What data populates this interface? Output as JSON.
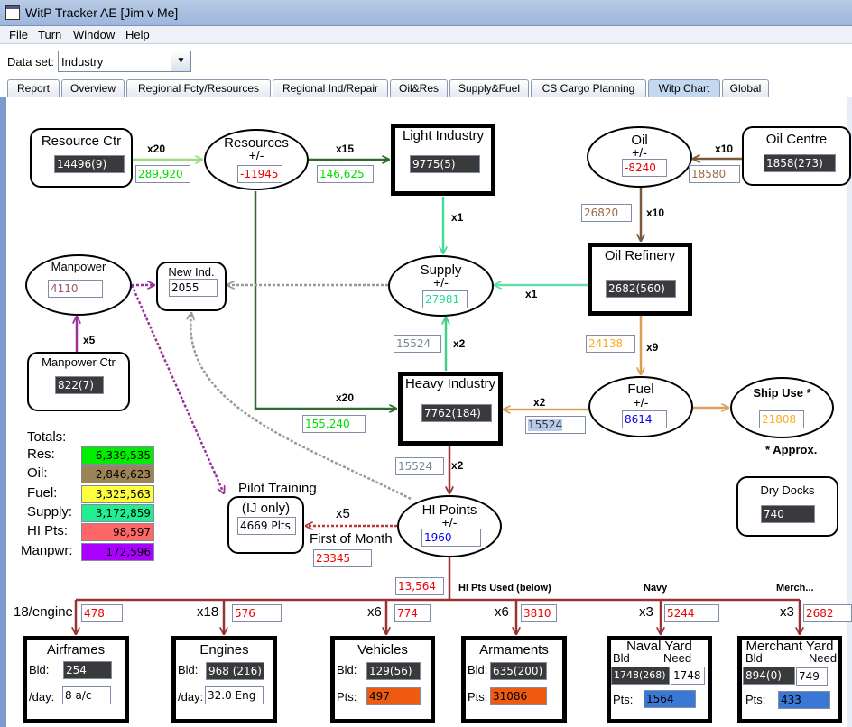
{
  "window": {
    "title": "WitP Tracker AE [Jim v Me]"
  },
  "menu": [
    "File",
    "Turn",
    "Window",
    "Help"
  ],
  "dataset": {
    "label": "Data set:",
    "value": "Industry"
  },
  "tabs": [
    "Report",
    "Overview",
    "Regional Fcty/Resources",
    "Regional Ind/Repair",
    "Oil&Res",
    "Supply&Fuel",
    "CS Cargo Planning",
    "Witp Chart",
    "Global"
  ],
  "selected_tab": "Witp Chart",
  "nodes": {
    "resource_ctr": {
      "title": "Resource Ctr",
      "value": "14496(9)"
    },
    "resources": {
      "title": "Resources",
      "sub": "+/-",
      "value": "-11945"
    },
    "light_industry": {
      "title": "Light Industry",
      "value": "9775(5)"
    },
    "oil": {
      "title": "Oil",
      "sub": "+/-",
      "value": "-8240"
    },
    "oil_centre": {
      "title": "Oil Centre",
      "value": "1858(273)"
    },
    "oil_refinery": {
      "title": "Oil Refinery",
      "value": "2682(560)"
    },
    "supply": {
      "title": "Supply",
      "sub": "+/-",
      "value": "27981"
    },
    "manpower": {
      "title": "Manpower",
      "value": "4110"
    },
    "new_ind": {
      "title": "New Ind.",
      "value": "2055"
    },
    "manpower_ctr": {
      "title": "Manpower Ctr",
      "value": "822(7)"
    },
    "heavy_industry": {
      "title": "Heavy Industry",
      "value": "7762(184)"
    },
    "fuel": {
      "title": "Fuel",
      "sub": "+/-",
      "value": "8614"
    },
    "ship_use": {
      "title": "Ship Use *",
      "value": "21808"
    },
    "approx": "* Approx.",
    "dry_docks": {
      "title": "Dry Docks",
      "value": "740"
    },
    "hi_points": {
      "title": "HI Points",
      "sub": "+/-",
      "value": "1960"
    },
    "pilot_training": {
      "title": "Pilot Training",
      "sub": "(IJ only)",
      "value": "4669 Plts"
    }
  },
  "flows": {
    "rc_res": {
      "mult": "x20",
      "value": "289,920"
    },
    "res_li": {
      "mult": "x15",
      "value": "146,625"
    },
    "oc_oil": {
      "mult": "x10",
      "value": "18580"
    },
    "oil_ref": {
      "mult": "x10",
      "value": "26820"
    },
    "li_sup": {
      "mult": "x1"
    },
    "ref_sup": {
      "mult": "x1"
    },
    "mpc_mp": {
      "mult": "x5"
    },
    "hi_sup": {
      "mult": "x2",
      "value": "15524"
    },
    "ref_fuel": {
      "mult": "x9",
      "value": "24138"
    },
    "res_hi": {
      "mult": "x20",
      "value": "155,240"
    },
    "fuel_hi": {
      "mult": "x2",
      "value": "15524"
    },
    "hi_hip": {
      "mult": "x2",
      "value": "15524"
    },
    "hip_pilot": {
      "mult": "x5",
      "note": "First of Month",
      "value": "23345"
    },
    "hip_used": {
      "value": "13,564",
      "label": "HI Pts Used (below)"
    }
  },
  "section_labels": {
    "navy": "Navy",
    "merch": "Merch..."
  },
  "totals": {
    "title": "Totals:",
    "rows": [
      {
        "label": "Res:",
        "value": "6,339,535",
        "color": "#00ee00"
      },
      {
        "label": "Oil:",
        "value": "2,846,623",
        "color": "#9c8456"
      },
      {
        "label": "Fuel:",
        "value": "3,325,563",
        "color": "#ffff40"
      },
      {
        "label": "Supply:",
        "value": "3,172,859",
        "color": "#20ee90"
      },
      {
        "label": "HI Pts:",
        "value": "98,597",
        "color": "#ff6666"
      },
      {
        "label": "Manpwr:",
        "value": "172,596",
        "color": "#aa00ff"
      }
    ]
  },
  "production": [
    {
      "mult": "18/engine",
      "used": "478",
      "title": "Airframes",
      "r1": "Bld:",
      "v1": "254",
      "r2": "/day:",
      "v2": "8 a/c"
    },
    {
      "mult": "x18",
      "used": "576",
      "title": "Engines",
      "r1": "Bld:",
      "v1": "968 (216)",
      "r2": "/day:",
      "v2": "32.0 Eng"
    },
    {
      "mult": "x6",
      "used": "774",
      "title": "Vehicles",
      "r1": "Bld:",
      "v1": "129(56)",
      "r2": "Pts:",
      "v2": "497"
    },
    {
      "mult": "x6",
      "used": "3810",
      "title": "Armaments",
      "r1": "Bld:",
      "v1": "635(200)",
      "r2": "Pts:",
      "v2": "31086"
    },
    {
      "mult": "x3",
      "used": "5244",
      "title": "Naval Yard",
      "h1": "Bld",
      "h2": "Need",
      "v1": "1748(268)",
      "need": "1748",
      "r2": "Pts:",
      "v2": "1564"
    },
    {
      "mult": "x3",
      "used": "2682",
      "title": "Merchant Yard",
      "h1": "Bld",
      "h2": "Need",
      "v1": "894(0)",
      "need": "749",
      "r2": "Pts:",
      "v2": "433"
    }
  ]
}
